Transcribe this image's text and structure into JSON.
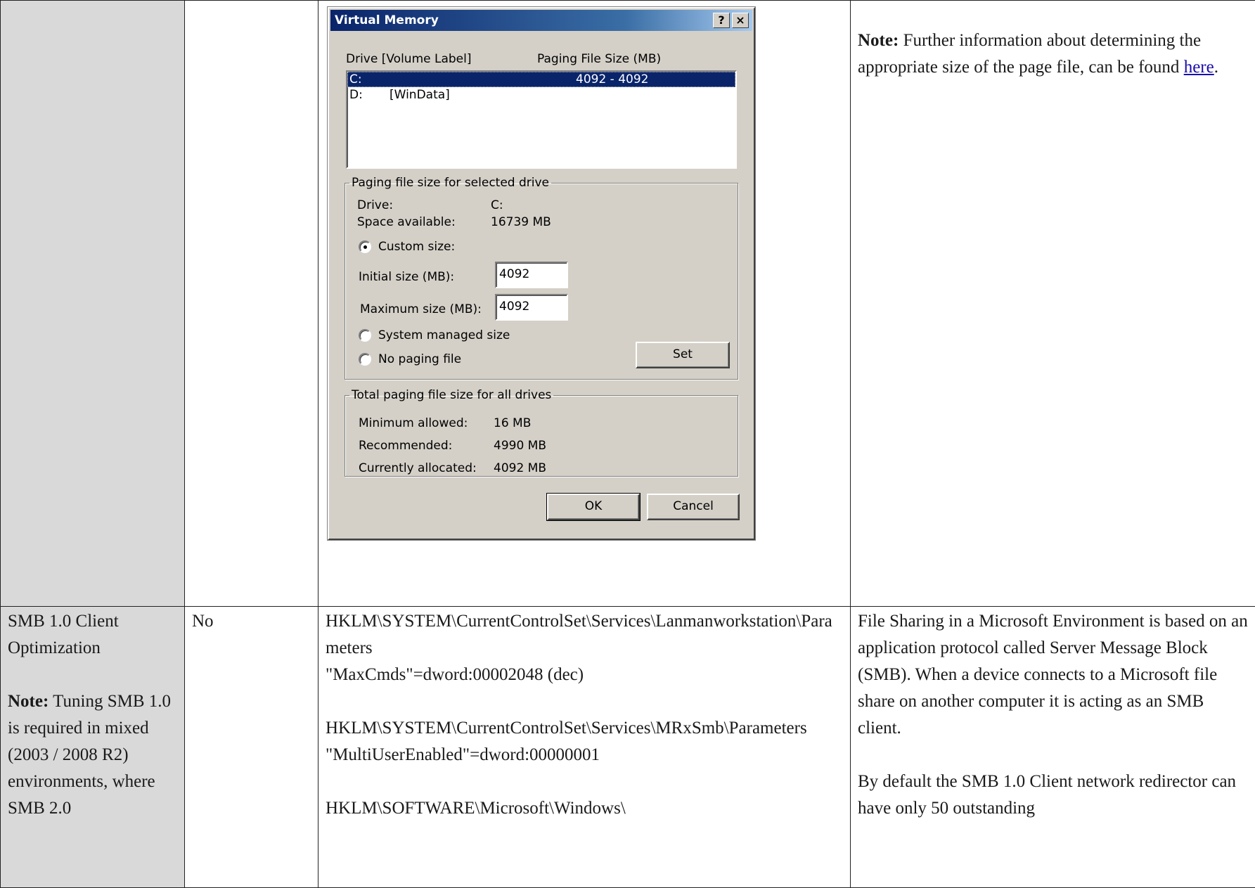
{
  "dialog": {
    "title": "Virtual Memory",
    "help_button": "?",
    "close_button": "×",
    "col_drive": "Drive  [Volume Label]",
    "col_size": "Paging File Size (MB)",
    "drives": [
      {
        "drive": "C:",
        "label": "",
        "size": "4092 - 4092",
        "selected": true
      },
      {
        "drive": "D:",
        "label": "[WinData]",
        "size": "",
        "selected": false
      }
    ],
    "selected_group": {
      "legend": "Paging file size for selected drive",
      "drive_label": "Drive:",
      "drive_value": "C:",
      "space_label": "Space available:",
      "space_value": "16739 MB",
      "custom_label": "Custom size:",
      "initial_label": "Initial size (MB):",
      "initial_value": "4092",
      "maximum_label": "Maximum size (MB):",
      "maximum_value": "4092",
      "system_label": "System managed size",
      "nopaging_label": "No paging file",
      "set_button": "Set",
      "selected_option": "custom"
    },
    "total_group": {
      "legend": "Total paging file size for all drives",
      "min_label": "Minimum allowed:",
      "min_value": "16 MB",
      "rec_label": "Recommended:",
      "rec_value": "4990 MB",
      "cur_label": "Currently allocated:",
      "cur_value": "4092 MB"
    },
    "ok_button": "OK",
    "cancel_button": "Cancel"
  },
  "row1": {
    "note_bold": "Note:",
    "note_text": " Further information about determining the appropriate size of the page file, can be found ",
    "note_link": "here",
    "note_end": "."
  },
  "row2": {
    "setting": "SMB 1.0 Client Optimization",
    "note_bold": "Note:",
    "note_text": " Tuning SMB 1.0 is required in mixed (2003 / 2008 R2) environments, where SMB 2.0",
    "required": "No",
    "reg1_path": "HKLM\\SYSTEM\\CurrentControlSet\\Services\\Lanmanworkstation\\Parameters",
    "reg1_value": "\"MaxCmds\"=dword:00002048 (dec)",
    "reg2_path": "HKLM\\SYSTEM\\CurrentControlSet\\Services\\MRxSmb\\Parameters",
    "reg2_value": "\"MultiUserEnabled\"=dword:00000001",
    "reg3_path": "HKLM\\SOFTWARE\\Microsoft\\Windows\\",
    "desc_p1": "File Sharing in a Microsoft Environment is based on an application protocol called Server Message Block (SMB).  When a device connects to a Microsoft file share on another computer it is acting as an SMB client.",
    "desc_p2": "By default the SMB 1.0 Client network redirector can have only 50 outstanding"
  }
}
